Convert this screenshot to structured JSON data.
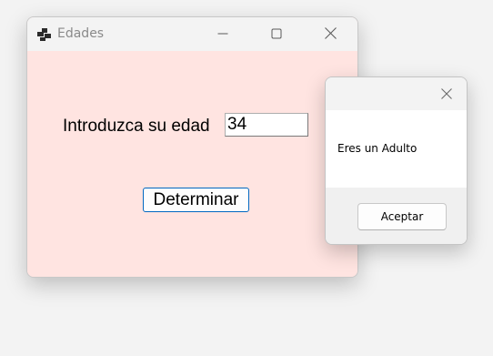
{
  "main_window": {
    "title": "Edades",
    "app_icon": "app-icon",
    "controls": [
      "minimize-icon",
      "maximize-icon",
      "close-icon"
    ],
    "background_color": "#ffe4e1",
    "form": {
      "age_label": "Introduzca su edad",
      "age_value": "34",
      "determine_label": "Determinar"
    }
  },
  "message_box": {
    "close_icon": "close-icon",
    "message": "Eres un Adulto",
    "accept_label": "Aceptar"
  }
}
